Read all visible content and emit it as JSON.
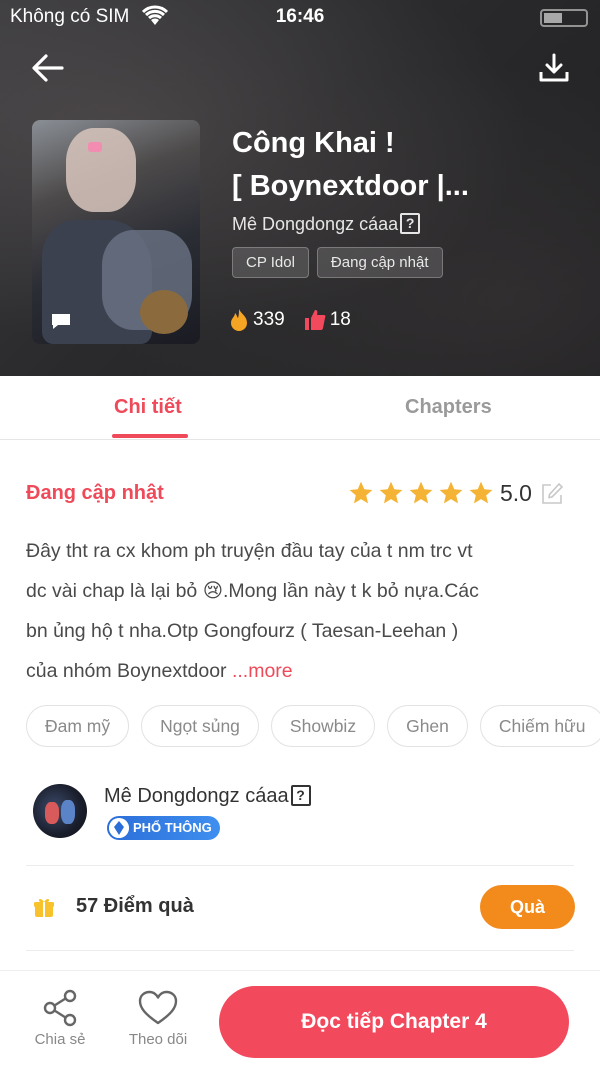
{
  "status_bar": {
    "carrier": "Không có SIM",
    "time": "16:46"
  },
  "header": {
    "back_icon": "arrow-left-icon",
    "download_icon": "download-icon"
  },
  "story": {
    "title_line1": "Công Khai !",
    "title_line2": "[ Boynextdoor |...",
    "author": "Mê Dongdongz cáaa",
    "author_badge": "?",
    "tags": [
      "CP Idol",
      "Đang cập nhật"
    ],
    "fire_count": "339",
    "like_count": "18"
  },
  "tabs": {
    "detail": "Chi tiết",
    "chapters": "Chapters"
  },
  "detail": {
    "status": "Đang cập nhật",
    "rating": "5.0",
    "stars": 5,
    "description_lines": [
      "Đây tht ra cx khom ph truyện đầu tay của t nm trc vt",
      "dc vài chap là lại bỏ 😢.Mong lần này t k bỏ nựa.Các",
      "bn ủng hộ t nha.Otp Gongfourz ( Taesan-Leehan )",
      "của nhóm Boynextdoor"
    ],
    "more_label": "...more",
    "genres": [
      "Đam mỹ",
      "Ngọt sủng",
      "Showbiz",
      "Ghen",
      "Chiếm hữu"
    ]
  },
  "uploader": {
    "name": "Mê Dongdongz cáaa",
    "badge": "?",
    "level": "PHỔ THÔNG"
  },
  "points": {
    "label": "57 Điểm quà",
    "button": "Quà"
  },
  "bottom_bar": {
    "share": "Chia sẻ",
    "follow": "Theo dõi",
    "read": "Đọc tiếp Chapter 4"
  },
  "colors": {
    "accent": "#ef4a5a",
    "gift_button": "#f28a1c",
    "star": "#f5b335",
    "level_badge": "#2b6ed8"
  }
}
